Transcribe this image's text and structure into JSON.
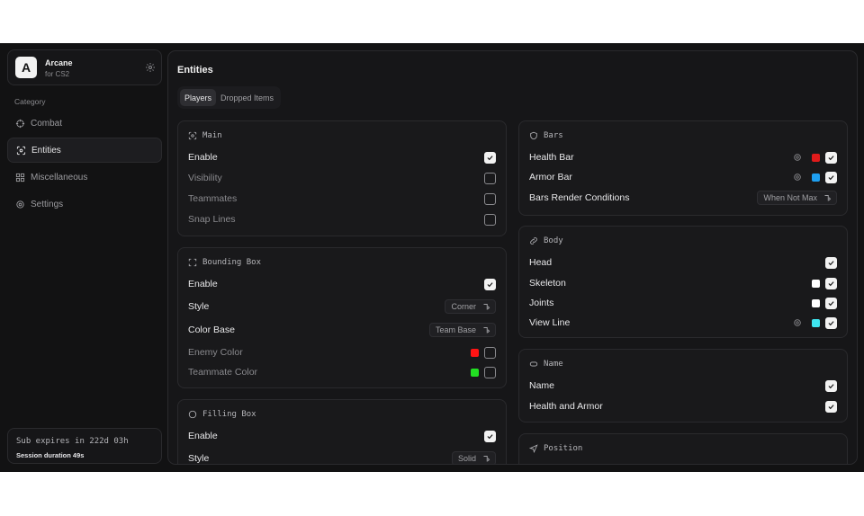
{
  "brand": {
    "logo_letter": "A",
    "name": "Arcane",
    "subtitle": "for CS2"
  },
  "sidebar": {
    "category_label": "Category",
    "items": [
      {
        "label": "Combat",
        "icon": "crosshair-icon"
      },
      {
        "label": "Entities",
        "icon": "scan-face-icon",
        "active": true
      },
      {
        "label": "Miscellaneous",
        "icon": "grid-icon"
      },
      {
        "label": "Settings",
        "icon": "gear-icon"
      }
    ],
    "subscription": {
      "expires": "Sub expires in 222d 03h",
      "session": "Session duration 49s"
    }
  },
  "main": {
    "title": "Entities",
    "tabs": [
      {
        "label": "Players",
        "active": true
      },
      {
        "label": "Dropped Items"
      }
    ]
  },
  "cards": {
    "main": {
      "title": "Main",
      "rows": [
        {
          "label": "Enable",
          "checked": true
        },
        {
          "label": "Visibility",
          "checked": false
        },
        {
          "label": "Teammates",
          "checked": false
        },
        {
          "label": "Snap Lines",
          "checked": false
        }
      ]
    },
    "bounding_box": {
      "title": "Bounding Box",
      "enable": "Enable",
      "style_label": "Style",
      "style_value": "Corner",
      "color_base_label": "Color Base",
      "color_base_value": "Team Base",
      "enemy_color_label": "Enemy Color",
      "enemy_color": "#ff1414",
      "teammate_color_label": "Teammate Color",
      "teammate_color": "#22e022"
    },
    "filling_box": {
      "title": "Filling Box",
      "enable": "Enable",
      "style_label": "Style",
      "style_value": "Solid"
    },
    "bars": {
      "title": "Bars",
      "health_label": "Health Bar",
      "health_color": "#e01b1b",
      "armor_label": "Armor Bar",
      "armor_color": "#1e9ff0",
      "render_label": "Bars Render Conditions",
      "render_value": "When Not Max"
    },
    "body": {
      "title": "Body",
      "head_label": "Head",
      "skeleton_label": "Skeleton",
      "skeleton_color": "#ffffff",
      "joints_label": "Joints",
      "joints_color": "#ffffff",
      "view_line_label": "View Line",
      "view_line_color": "#3fe6f0"
    },
    "name": {
      "title": "Name",
      "name_label": "Name",
      "health_armor_label": "Health and Armor"
    },
    "position": {
      "title": "Position"
    }
  }
}
